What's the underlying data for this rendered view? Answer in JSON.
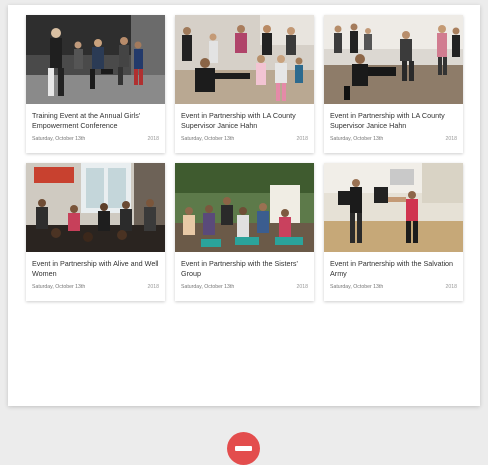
{
  "events": [
    {
      "title": "Training Event at the Annual Girls' Empowerment Conference",
      "date": "Saturday, October 13th",
      "year": "2018",
      "photo": "photo-self-defense-training-dark-room"
    },
    {
      "title": "Event in Partnership with LA County Supervisor Janice Hahn",
      "date": "Saturday, October 13th",
      "year": "2018",
      "photo": "photo-kick-demonstration-gym"
    },
    {
      "title": "Event in Partnership with LA County Supervisor Janice Hahn",
      "date": "Saturday, October 13th",
      "year": "2018",
      "photo": "photo-pad-kick-practice"
    },
    {
      "title": "Event in Partnership with Alive and Well Women",
      "date": "Saturday, October 13th",
      "year": "2018",
      "photo": "photo-audience-seated-indoor"
    },
    {
      "title": "Event in Partnership with the Sisters' Group",
      "date": "Saturday, October 13th",
      "year": "2018",
      "photo": "photo-outdoor-seated-group"
    },
    {
      "title": "Event in Partnership with the Salvation Army",
      "date": "Saturday, October 13th",
      "year": "2018",
      "photo": "photo-gym-strike-practice"
    }
  ],
  "colors": {
    "remove_button": "#e34d4d",
    "panel_background": "#ffffff",
    "page_background": "#ececec"
  },
  "icons": {
    "remove": "minus-circle-icon"
  }
}
